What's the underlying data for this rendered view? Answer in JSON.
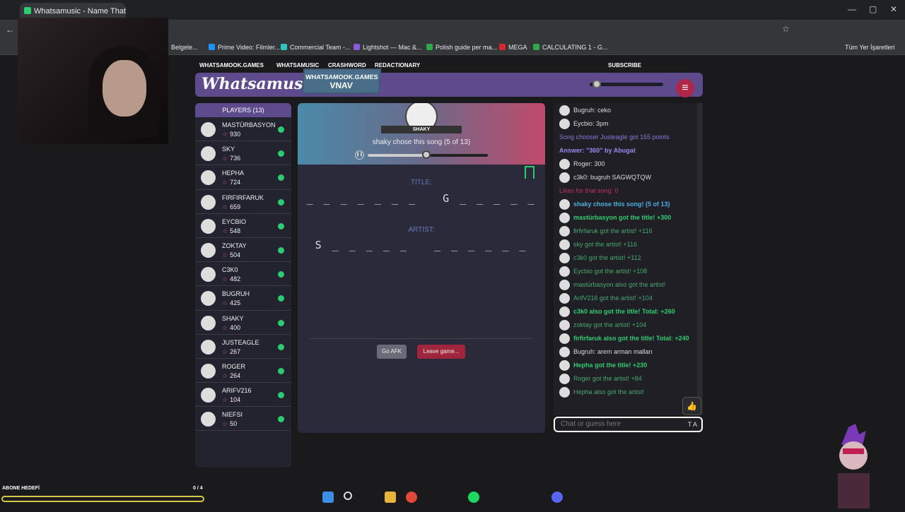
{
  "browser": {
    "tab_title": "Whatsamusic - Name That",
    "bookmarks": [
      "Belgele...",
      "Prime Video: Filmler...",
      "Commercial Team -...",
      "Lightshot — Mac &...",
      "Polish guide per ma...",
      "MEGA",
      "CALCULATING 1 - G...",
      "Tüm Yer İşaretleri"
    ]
  },
  "nav": {
    "items": [
      "WHATSAMOOK.GAMES",
      "WHATSAMUSIC",
      "CRASHWORD",
      "REDACTIONARY"
    ],
    "subscribe": "SUBSCRIBE"
  },
  "header": {
    "logo": "Whatsamusic",
    "site": "WHATSAMOOK.GAMES",
    "room": "VNAV",
    "menu": "≡"
  },
  "players": {
    "title": "PLAYERS (13)",
    "list": [
      {
        "name": "MASTÜRBASYON",
        "score": "930"
      },
      {
        "name": "SKY",
        "score": "736"
      },
      {
        "name": "HEPHA",
        "score": "724"
      },
      {
        "name": "FIRFIRFARUK",
        "score": "659"
      },
      {
        "name": "EYCBIO",
        "score": "548"
      },
      {
        "name": "ZOKTAY",
        "score": "504"
      },
      {
        "name": "C3K0",
        "score": "482"
      },
      {
        "name": "BUGRUH",
        "score": "425"
      },
      {
        "name": "SHAKY",
        "score": "400"
      },
      {
        "name": "JUSTEAGLE",
        "score": "267"
      },
      {
        "name": "ROGER",
        "score": "264"
      },
      {
        "name": "ARIFV216",
        "score": "104"
      },
      {
        "name": "NIEFSI",
        "score": "50"
      }
    ]
  },
  "game": {
    "chooser": "SHAKY",
    "chose_text": "shaky chose this song (5 of 13)",
    "progress": 0.49,
    "title_label": "TITLE:",
    "title_blanks": "_ _ _ _ _ _ _   G _ _ _ _ _",
    "artist_label": "ARTIST:",
    "artist_blanks": "S _ _ _ _ _   _ _ _ _ _ _",
    "afk_button": "Go AFK",
    "leave_button": "Leave game..."
  },
  "chat": {
    "placeholder": "Chat or guess here",
    "input_hint": "T A",
    "messages": [
      {
        "text": "Bugruh: ceko",
        "color": "#dddddd",
        "av": true
      },
      {
        "text": "Eycbio: 3pm",
        "color": "#dddddd",
        "av": true
      },
      {
        "text": "Song chooser Justeagle got 155 points",
        "color": "#8a7ad8",
        "av": false
      },
      {
        "text": "Answer: \"360\" by Abugat",
        "color": "#9a8af0",
        "av": false,
        "bold": true
      },
      {
        "text": "Roger: 300",
        "color": "#dddddd",
        "av": true
      },
      {
        "text": "c3k0: bugruh SAGWQTQW",
        "color": "#dddddd",
        "av": true
      },
      {
        "text": "Likes for that song: 0",
        "color": "#c0306a",
        "av": false
      },
      {
        "text": "shaky chose this song! (5 of 13)",
        "color": "#4aaee0",
        "av": true,
        "bold": true
      },
      {
        "text": "mastürbasyon got the title! +300",
        "color": "#2ecc71",
        "av": true,
        "bold": true
      },
      {
        "text": "firfirfaruk got the artist! +116",
        "color": "#4aa870",
        "av": true
      },
      {
        "text": "sky got the artist! +116",
        "color": "#4aa870",
        "av": true
      },
      {
        "text": "c3k0 got the artist! +112",
        "color": "#4aa870",
        "av": true
      },
      {
        "text": "Eycbio got the artist! +108",
        "color": "#4aa870",
        "av": true
      },
      {
        "text": "mastürbasyon also got the artist!",
        "color": "#4aa870",
        "av": true
      },
      {
        "text": "ArifV216 got the artist! +104",
        "color": "#4aa870",
        "av": true
      },
      {
        "text": "c3k0 also got the title! Total: +260",
        "color": "#2ecc71",
        "av": true,
        "bold": true
      },
      {
        "text": "zoktay got the artist! +104",
        "color": "#4aa870",
        "av": true
      },
      {
        "text": "firfirfaruk also got the title! Total: +240",
        "color": "#2ecc71",
        "av": true,
        "bold": true
      },
      {
        "text": "Bugruh: arem arman malları",
        "color": "#dddddd",
        "av": true
      },
      {
        "text": "Hepha got the title! +230",
        "color": "#2ecc71",
        "av": true,
        "bold": true
      },
      {
        "text": "Roger got the artist! +84",
        "color": "#4aa870",
        "av": true
      },
      {
        "text": "Hepha also got the artist!",
        "color": "#4aa870",
        "av": true
      }
    ]
  },
  "overlay": {
    "abone_label": "ABONE HEDEFİ",
    "abone_count": "0 / 4"
  }
}
